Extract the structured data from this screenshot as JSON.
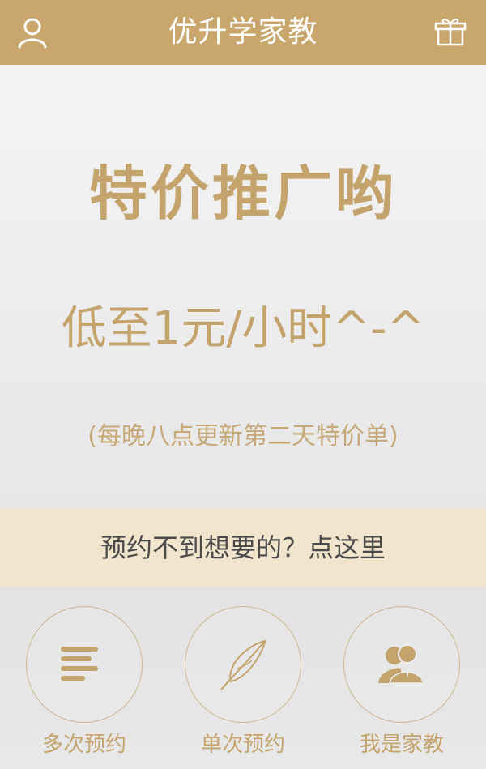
{
  "header": {
    "title": "优升学家教",
    "left_icon": "user-icon",
    "right_icon": "gift-icon"
  },
  "hero": {
    "headline": "特价推广哟",
    "price": "低至1元/小时^-^",
    "note": "(每晚八点更新第二天特价单)"
  },
  "cta": {
    "label": "预约不到想要的？点这里"
  },
  "bottom_nav": {
    "items": [
      {
        "label": "多次预约",
        "icon": "list-lines-icon"
      },
      {
        "label": "单次预约",
        "icon": "feather-icon"
      },
      {
        "label": "我是家教",
        "icon": "people-icon"
      }
    ]
  },
  "colors": {
    "header_bg": "#c9a66b",
    "accent_text": "#c4a46c",
    "cta_bg": "#f1e5cd"
  }
}
